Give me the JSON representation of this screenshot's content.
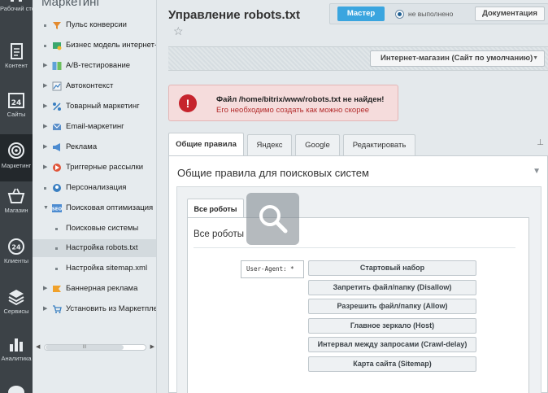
{
  "rail": [
    {
      "name": "rail-desktop",
      "label": "Рабочий стол"
    },
    {
      "name": "rail-content",
      "label": "Контент"
    },
    {
      "name": "rail-sites",
      "label": "Сайты",
      "icon_text": "24"
    },
    {
      "name": "rail-marketing",
      "label": "Маркетинг"
    },
    {
      "name": "rail-shop",
      "label": "Магазин"
    },
    {
      "name": "rail-clients",
      "label": "Клиенты",
      "icon_text": "24"
    },
    {
      "name": "rail-services",
      "label": "Сервисы"
    },
    {
      "name": "rail-analytics",
      "label": "Аналитика"
    }
  ],
  "menu": {
    "title": "Маркетинг",
    "items": [
      {
        "label": "Пульс конверсии",
        "marker": "dot"
      },
      {
        "label": "Бизнес модель интернет-м",
        "marker": "dot"
      },
      {
        "label": "A/B-тестирование",
        "marker": "arrow"
      },
      {
        "label": "Автоконтекст",
        "marker": "arrow"
      },
      {
        "label": "Товарный маркетинг",
        "marker": "arrow"
      },
      {
        "label": "Email-маркетинг",
        "marker": "arrow"
      },
      {
        "label": "Реклама",
        "marker": "arrow"
      },
      {
        "label": "Триггерные рассылки",
        "marker": "arrow"
      },
      {
        "label": "Персонализация",
        "marker": "dot"
      },
      {
        "label": "Поисковая оптимизация",
        "marker": "arrow-down"
      },
      {
        "label": "Поисковые системы",
        "marker": "sub"
      },
      {
        "label": "Настройка robots.txt",
        "marker": "sub"
      },
      {
        "label": "Настройка sitemap.xml",
        "marker": "sub"
      },
      {
        "label": "Баннерная реклама",
        "marker": "arrow"
      },
      {
        "label": "Установить из Маркетплейс",
        "marker": "arrow"
      }
    ],
    "selected_index": 11,
    "scroll_thumb": "III"
  },
  "header": {
    "title": "Управление robots.txt",
    "star": "☆"
  },
  "wizard": {
    "button": "Мастер",
    "status": "не выполнено",
    "docs": "Документация"
  },
  "site_select": {
    "value": "Интернет-магазин (Сайт по умолчанию)"
  },
  "alert": {
    "title": "Файл /home/bitrix/www/robots.txt не найден!",
    "text": "Его необходимо создать как можно скорее"
  },
  "tabs": [
    {
      "label": "Общие правила"
    },
    {
      "label": "Яндекс"
    },
    {
      "label": "Google"
    },
    {
      "label": "Редактировать"
    }
  ],
  "panel": {
    "title": "Общие правила для поисковых систем",
    "inner_tab": "Все роботы",
    "heading": "Все роботы",
    "user_agent": "User-Agent: *"
  },
  "actions": [
    "Стартовый набор",
    "Запретить файл/папку (Disallow)",
    "Разрешить файл/папку (Allow)",
    "Главное зеркало (Host)",
    "Интервал между запросами (Crawl-delay)",
    "Карта сайта (Sitemap)"
  ],
  "colors": {
    "accent": "#3aa5df",
    "error": "#c6242d",
    "rail_bg": "#3c4247"
  }
}
